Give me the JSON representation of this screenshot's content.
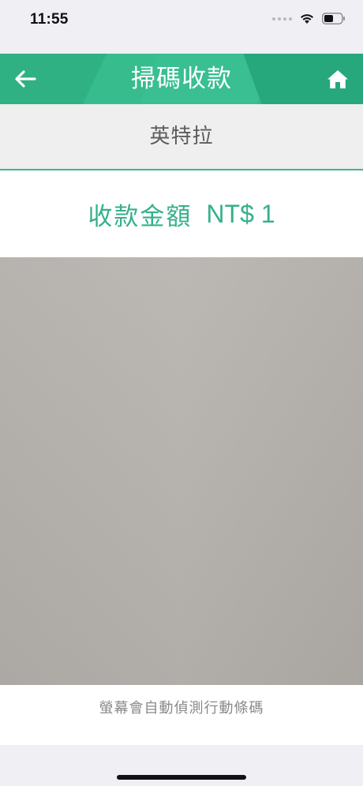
{
  "status_bar": {
    "time": "11:55"
  },
  "header": {
    "title": "掃碼收款",
    "back_icon": "arrow-left-icon",
    "home_icon": "home-icon",
    "background_color": "#33b98a"
  },
  "merchant": {
    "name": "英特拉"
  },
  "amount": {
    "label": "收款金額",
    "value": "NT$ 1",
    "color": "#35b08c"
  },
  "scanner": {
    "hint": "螢幕會自動偵測行動條碼"
  }
}
